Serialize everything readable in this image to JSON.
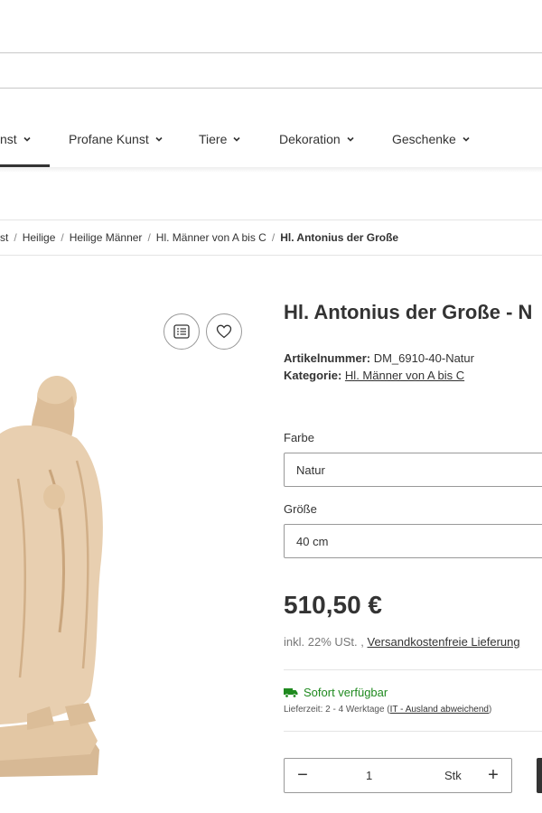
{
  "nav": {
    "items": [
      {
        "label": "nst"
      },
      {
        "label": "Profane Kunst"
      },
      {
        "label": "Tiere"
      },
      {
        "label": "Dekoration"
      },
      {
        "label": "Geschenke"
      }
    ]
  },
  "breadcrumb": {
    "items": [
      "st",
      "Heilige",
      "Heilige Männer",
      "Hl. Männer von A bis C"
    ],
    "current": "Hl. Antonius der Große"
  },
  "product": {
    "title": "Hl. Antonius der Große - N",
    "sku_label": "Artikelnummer:",
    "sku_value": "DM_6910-40-Natur",
    "category_label": "Kategorie:",
    "category_value": "Hl. Männer von A bis C",
    "color_label": "Farbe",
    "color_value": "Natur",
    "size_label": "Größe",
    "size_value": "40 cm",
    "price": "510,50 €",
    "tax_text": "inkl. 22% USt. ,",
    "shipping_link": "Versandkostenfreie Lieferung",
    "stock_text": "Sofort verfügbar",
    "delivery_prefix": "Lieferzeit: 2 - 4 Werktage (",
    "delivery_link": "IT - Ausland abweichend",
    "delivery_suffix": ")",
    "quantity": "1",
    "unit": "Stk",
    "minus_symbol": "−",
    "plus_symbol": "+"
  },
  "colors": {
    "stock_green": "#1f8a1f",
    "wood": "#e8cfb0"
  }
}
